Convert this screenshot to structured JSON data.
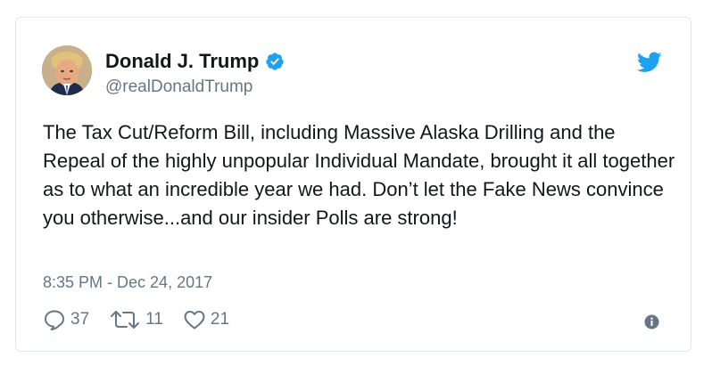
{
  "author": {
    "name": "Donald J. Trump",
    "handle": "@realDonaldTrump",
    "verified": true
  },
  "tweet": {
    "text": "The Tax Cut/Reform Bill, including Massive Alaska Drilling and the Repeal of the highly unpopular Individual Mandate, brought it all together as to what an incredible year we had. Don’t let the Fake News convince you otherwise...and our insider Polls are strong!",
    "timestamp": "8:35 PM - Dec 24, 2017"
  },
  "actions": {
    "replies": "37",
    "retweets": "11",
    "likes": "21"
  },
  "icons": [
    "verified-badge-icon",
    "twitter-bird-icon",
    "reply-icon",
    "retweet-icon",
    "like-icon",
    "info-icon"
  ],
  "colors": {
    "twitter_blue": "#1da1f2",
    "secondary_text": "#657786",
    "primary_text": "#14171a",
    "border": "#e1e8ed"
  }
}
